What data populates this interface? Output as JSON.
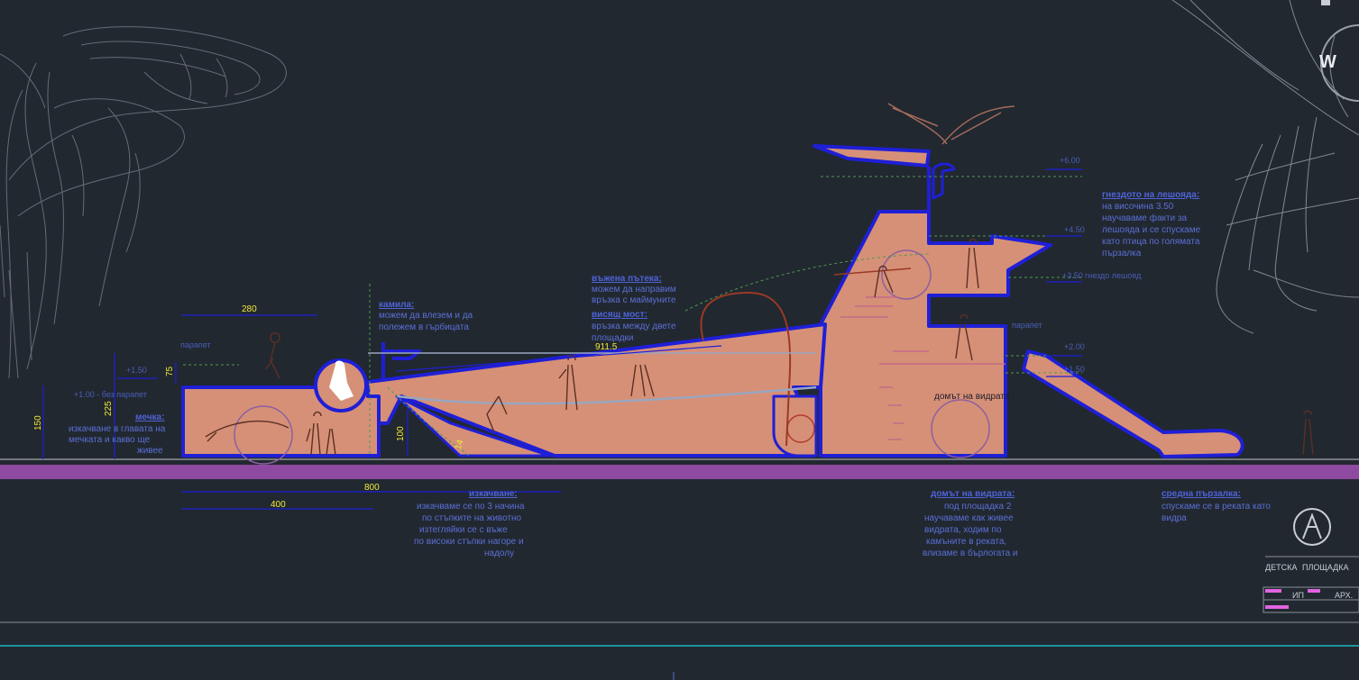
{
  "dimensions": {
    "d280": "280",
    "d75": "75",
    "d225": "225",
    "d150": "150",
    "d800": "800",
    "d400": "400",
    "d100": "100",
    "d14": "14",
    "d911": "911.5"
  },
  "levels": {
    "l600": "+6.00",
    "l450": "+4.50",
    "l350": "+3.50",
    "l200": "+2.00",
    "l150_r": "+1.50",
    "l150_l": "+1.50",
    "l100": "+1.00 - без парапет"
  },
  "notes": {
    "parapet_left": "парапет",
    "parapet_right": "парапет",
    "nest_inline": "гнездо лешояд",
    "otter_house_mark": "домът на видрата",
    "camel_title": "камила:",
    "camel_text": [
      "можем да влезем и да",
      "полежем  в гърбицата"
    ],
    "path_title": "въжена пътека:",
    "path_text": [
      "можем да направим",
      "връзка с маймуните"
    ],
    "bridge_title": "висящ мост:",
    "bridge_text": [
      "връзка между двете",
      "площадки"
    ],
    "bear_title": "мечка:",
    "bear_text": [
      "изкачване в главата на",
      "мечката и какво ще",
      "живее"
    ],
    "vulture_title": "гнездото на лешояда:",
    "vulture_text": [
      "на височина 3.50",
      "научаваме факти за",
      "лешояда и се спускаме",
      "като птица по голямата",
      "пързалка"
    ],
    "climb_title": "изкачване:",
    "climb_text": [
      "изкачваме се по 3 начина",
      "по стъпките на животно",
      "изтегляйки се с въже",
      "по високи стъпки нагоре и",
      "надолу"
    ],
    "otter_title": "домът на видрата:",
    "otter_text": [
      "под площадка 2",
      "научаваме как живее",
      "видрата, ходим по",
      "камъните в реката,",
      "влизаме в бърлогата и"
    ],
    "slide_title": "средна пързалка:",
    "slide_text": [
      "спускаме се в реката като",
      "видра"
    ]
  },
  "title_block": {
    "detska": "ДЕТСКА",
    "ploshtadka": "ПЛОЩАДКА",
    "ip": "ИП",
    "arh": "АРХ.",
    "logo_letter": "W"
  },
  "colors": {
    "background": "#212830",
    "structure_fill": "#d69077",
    "structure_outline": "#1f1fd6",
    "ground": "#8e4aa0",
    "accent_line": "#21b8c4",
    "dimension_text": "#f2ea36",
    "annotation_text": "#5c6fd6",
    "sketch_lines": "#8a8f98"
  }
}
